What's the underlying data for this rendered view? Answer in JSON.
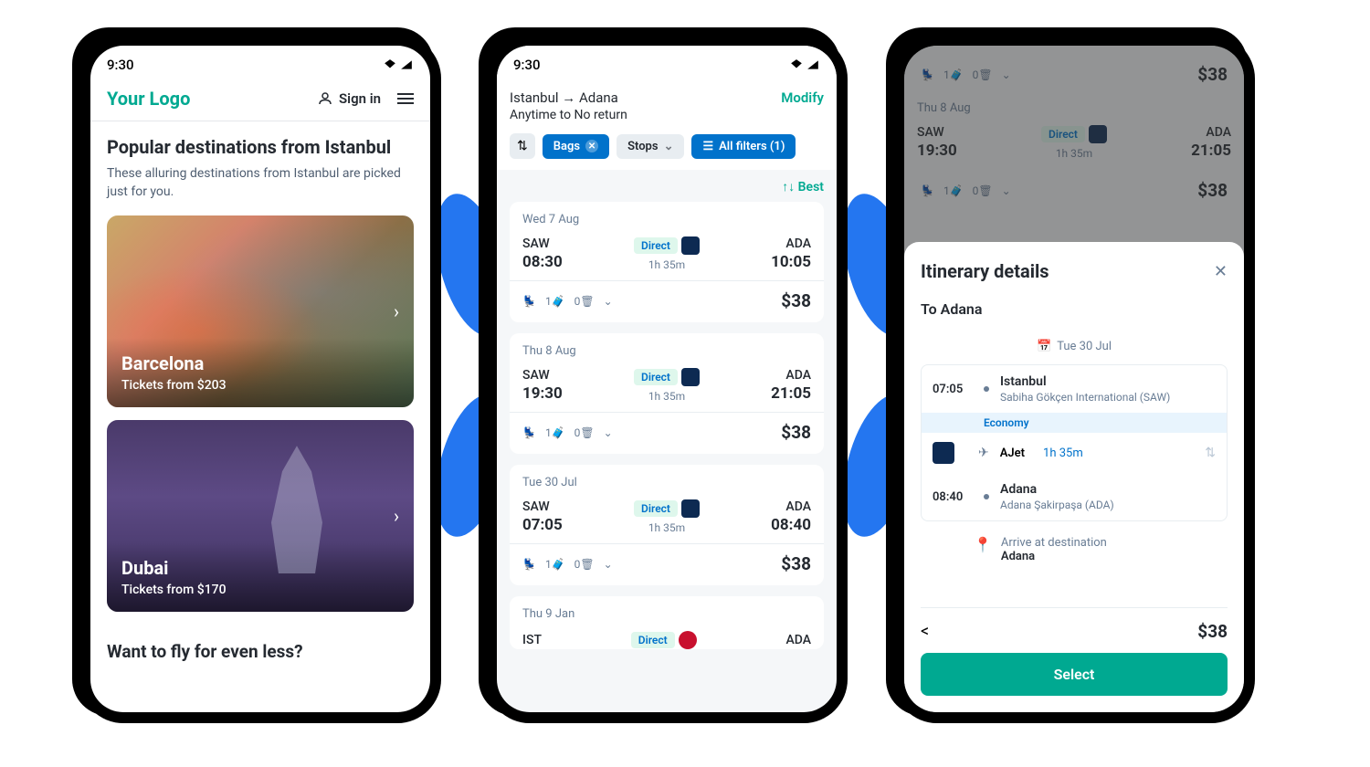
{
  "phone1": {
    "time": "9:30",
    "logo": "Your Logo",
    "signin": "Sign in",
    "heading": "Popular destinations from Istanbul",
    "subtitle": "These alluring destinations from Istanbul are picked just for you.",
    "destinations": [
      {
        "name": "Barcelona",
        "price": "Tickets from $203"
      },
      {
        "name": "Dubai",
        "price": "Tickets from $170"
      }
    ],
    "bottom_prompt": "Want to fly for even less?"
  },
  "phone2": {
    "time": "9:30",
    "route": "Istanbul → Adana",
    "dates": "Anytime to No return",
    "modify": "Modify",
    "filters": {
      "bags": "Bags",
      "stops": "Stops",
      "all": "All filters (1)"
    },
    "sort": "Best",
    "flights": [
      {
        "date": "Wed 7 Aug",
        "from": "SAW",
        "depart": "08:30",
        "to": "ADA",
        "arrive": "10:05",
        "direct": "Direct",
        "duration": "1h 35m",
        "bags": "1",
        "checked": "0",
        "price": "$38"
      },
      {
        "date": "Thu 8 Aug",
        "from": "SAW",
        "depart": "19:30",
        "to": "ADA",
        "arrive": "21:05",
        "direct": "Direct",
        "duration": "1h 35m",
        "bags": "1",
        "checked": "0",
        "price": "$38"
      },
      {
        "date": "Tue 30 Jul",
        "from": "SAW",
        "depart": "07:05",
        "to": "ADA",
        "arrive": "08:40",
        "direct": "Direct",
        "duration": "1h 35m",
        "bags": "1",
        "checked": "0",
        "price": "$38"
      },
      {
        "date": "Thu 9 Jan",
        "from": "IST",
        "to": "ADA",
        "direct": "Direct"
      }
    ]
  },
  "phone3": {
    "bg": {
      "price_top": "$38",
      "date": "Thu 8 Aug",
      "from": "SAW",
      "depart": "19:30",
      "to": "ADA",
      "arrive": "21:05",
      "direct": "Direct",
      "duration": "1h 35m",
      "price_bottom": "$38"
    },
    "sheet": {
      "title": "Itinerary details",
      "to": "To Adana",
      "date": "Tue 30 Jul",
      "depart_time": "07:05",
      "depart_city": "Istanbul",
      "depart_airport": "Sabiha Gökçen International (SAW)",
      "class": "Economy",
      "carrier": "AJet",
      "duration": "1h 35m",
      "arrive_time": "08:40",
      "arrive_city": "Adana",
      "arrive_airport": "Adana Şakirpaşa (ADA)",
      "arrive_label": "Arrive at destination",
      "arrive_dest": "Adana",
      "price": "$38",
      "select": "Select"
    }
  }
}
